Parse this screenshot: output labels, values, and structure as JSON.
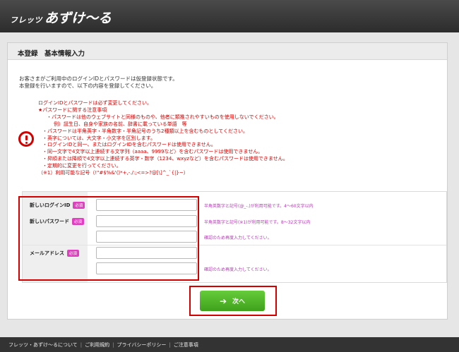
{
  "header": {
    "logo_small": "フレッツ",
    "logo_big": "あずけ〜る"
  },
  "page": {
    "title": "本登録　基本情報入力"
  },
  "intro": {
    "line1": "お客さまがご利用中のログインIDとパスワードは仮登録状態です。",
    "line2": "本登録を行いますので、以下の内容を登録してください。"
  },
  "notes": {
    "line1": "ログインIDとパスワードは必ず変更してください。",
    "line2": "★パスワードに関する注意事項",
    "line3": "・パスワードは他のウェブサイトと同様のものや、他者に類推されやすいものを使用しないでください。",
    "line4": "例）誕生日、自身や家族の名前、辞書に載っている単語　等",
    "line5": "・パスワードは半角英字・半角数字・半角記号のうち2種類以上を含むものとしてください。",
    "line6": "・英字については、大文字・小文字を区別します。",
    "line7": "・ログインIDと同一、またはログインIDを含むパスワードは使用できません。",
    "line8": "・同一文字で4文字以上連続する文字列（aaaa、9999など）を含むパスワードは使用できません。",
    "line9": "・昇順または降順で4文字以上連続する英字・数字（1234、wxyzなど）を含むパスワードは使用できません。",
    "line10": "・定期的に変更を行ってください。",
    "line11": "（※1）利用可能な記号（!\"#$%&'()*+,-./:;<=>?@[\\]^_`{|}~）"
  },
  "form": {
    "required_badge": "必須",
    "login_id": {
      "label": "新しいログインID",
      "value": "",
      "hint": "半角英数字と記号(@_-.)が利用可能です。4〜60文字以内"
    },
    "password": {
      "label": "新しいパスワード",
      "value": "",
      "hint": "半角英数字と記号(※1)が利用可能です。8〜32文字以内"
    },
    "password_confirm": {
      "value": "",
      "hint": "確認のため再度入力してください。"
    },
    "email": {
      "label": "メールアドレス",
      "value": "",
      "hint": ""
    },
    "email_confirm": {
      "value": "",
      "hint": "確認のため再度入力してください。"
    }
  },
  "actions": {
    "next_label": "次へ",
    "next_icon": "arrow-right-icon"
  },
  "footer": {
    "links": [
      "フレッツ・あずけ〜るについて",
      "ご利用規約",
      "プライバシーポリシー",
      "ご注意事項"
    ]
  },
  "colors": {
    "header_bg": "#3a3a3a",
    "warning_red": "#d40000",
    "badge_magenta": "#e040c0",
    "hint_purple": "#b23ab2",
    "button_green": "#4fb32a"
  }
}
